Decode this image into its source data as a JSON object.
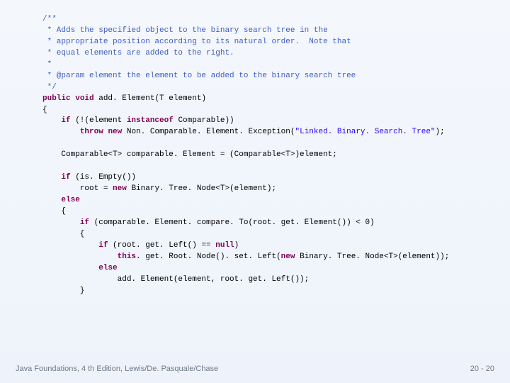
{
  "code": {
    "jd1": "/**",
    "jd2": " * Adds the specified object to the binary search tree in the",
    "jd3": " * appropriate position according to its natural order.  Note that",
    "jd4": " * equal elements are added to the right.",
    "jd5": " *",
    "jd6": " * @param element the element to be added to the binary search tree",
    "jd7": " */",
    "kw_public": "public",
    "kw_void": "void",
    "sig_rest": " add. Element(T element)",
    "brace_open": "{",
    "if1a": "    ",
    "kw_if1": "if",
    "if1b": " (!(element ",
    "kw_instanceof": "instanceof",
    "if1c": " Comparable))",
    "throw_indent": "        ",
    "kw_throw": "throw",
    "kw_new1": "new",
    "throw_rest": " Non. Comparable. Element. Exception(",
    "str_tree": "\"Linked. Binary. Search. Tree\"",
    "throw_end": ");",
    "blank": "",
    "cmp_line": "    Comparable<T> comparable. Element = (Comparable<T>)element;",
    "if2_indent": "    ",
    "kw_if2": "if",
    "if2_rest": " (is. Empty())",
    "root_indent": "        root = ",
    "kw_new2": "new",
    "root_rest": " Binary. Tree. Node<T>(element);",
    "else_indent": "    ",
    "kw_else1": "else",
    "brace2": "    {",
    "if3_indent": "        ",
    "kw_if3": "if",
    "if3_rest": " (comparable. Element. compare. To(root. get. Element()) < 0)",
    "brace3": "        {",
    "if4_indent": "            ",
    "kw_if4": "if",
    "if4_rest": " (root. get. Left() == ",
    "kw_null": "null",
    "if4_end": ")",
    "this_indent": "                ",
    "kw_this": "this",
    "this_rest": ". get. Root. Node(). set. Left(",
    "kw_new3": "new",
    "this_rest2": " Binary. Tree. Node<T>(element));",
    "else2_indent": "            ",
    "kw_else2": "else",
    "add_line": "                add. Element(element, root. get. Left());",
    "brace3_close": "        }"
  },
  "footer": {
    "left": "Java Foundations, 4 th Edition, Lewis/De. Pasquale/Chase",
    "right": "20 - 20"
  }
}
